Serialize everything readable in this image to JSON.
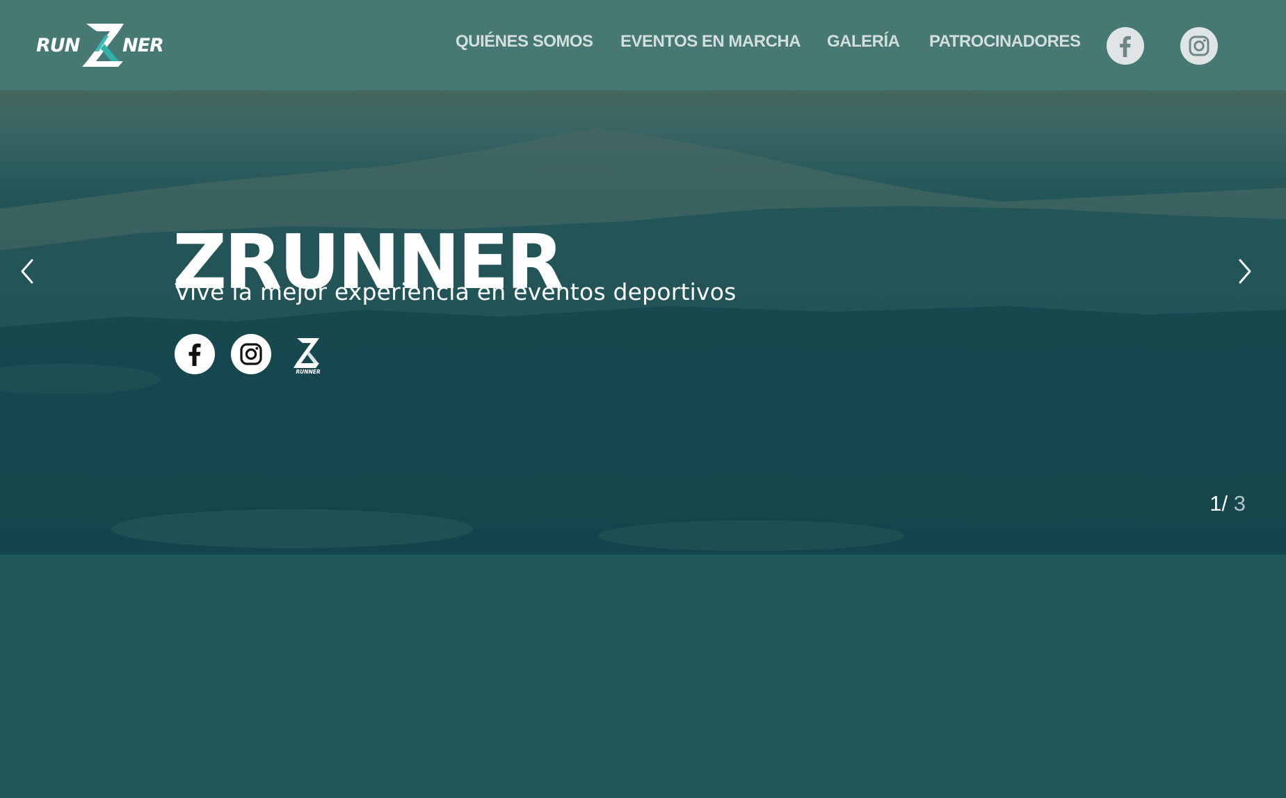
{
  "header": {
    "logo": {
      "text": "RUNZNER",
      "icon": "zrunner-logo"
    },
    "nav": [
      {
        "label": "QUIÉNES SOMOS"
      },
      {
        "label": "EVENTOS EN MARCHA"
      },
      {
        "label": "GALERÍA"
      },
      {
        "label": "PATROCINADORES"
      }
    ],
    "social": [
      {
        "icon": "facebook-icon"
      },
      {
        "icon": "instagram-icon"
      }
    ]
  },
  "hero": {
    "title": "ZRUNNER",
    "subtitle": "Vive la mejor experiencia en eventos deportivos",
    "social": [
      {
        "icon": "facebook-icon"
      },
      {
        "icon": "instagram-icon"
      },
      {
        "icon": "zrunner-logo",
        "text": "RUNNER"
      }
    ],
    "prev_icon": "chevron-left-icon",
    "next_icon": "chevron-right-icon",
    "slide_current": "1",
    "slide_separator": "/",
    "slide_total": "3"
  },
  "colors": {
    "header_bg": "#467a76",
    "page_bg": "#1f5658",
    "nav_text": "#d4dedc",
    "hero_text": "#ffffff",
    "counter_total": "#b6c6c5"
  }
}
